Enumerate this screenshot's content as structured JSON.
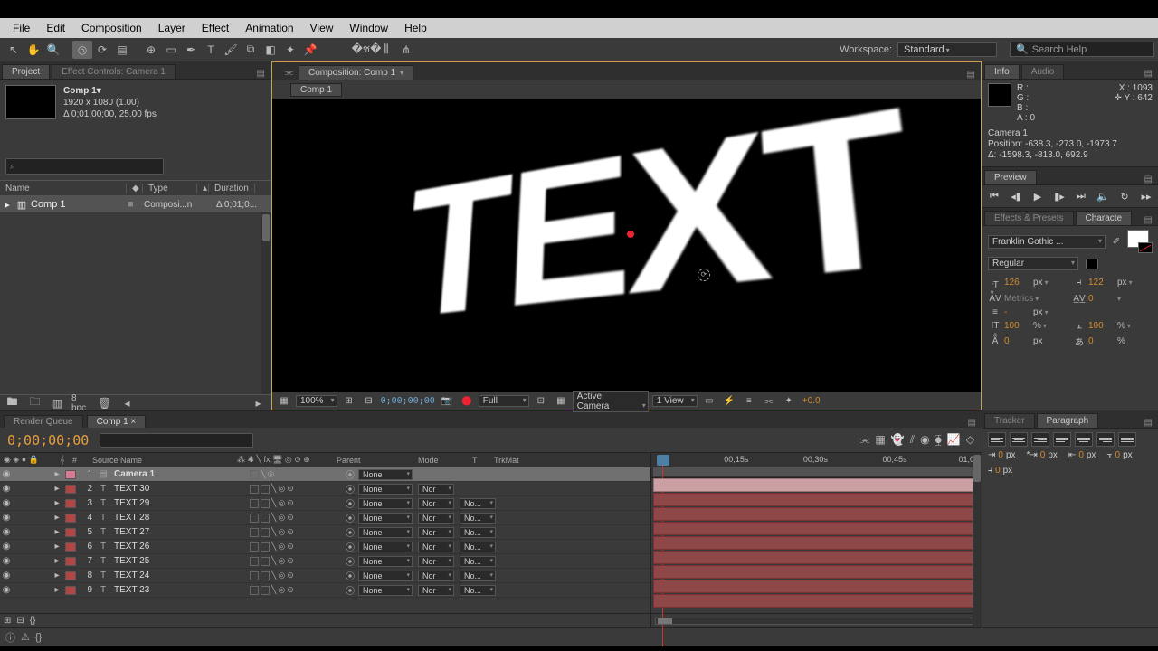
{
  "menu": [
    "File",
    "Edit",
    "Composition",
    "Layer",
    "Effect",
    "Animation",
    "View",
    "Window",
    "Help"
  ],
  "workspace": {
    "label": "Workspace:",
    "value": "Standard"
  },
  "search_help": "Search Help",
  "left": {
    "tabs": {
      "project": "Project",
      "fx": "Effect Controls: Camera 1"
    },
    "comp": {
      "title": "Comp 1▾",
      "dims": "1920 x 1080 (1.00)",
      "dur": "Δ 0;01;00;00, 25.00 fps"
    },
    "cols": {
      "name": "Name",
      "type": "Type",
      "duration": "Duration"
    },
    "row": {
      "name": "Comp 1",
      "type": "Composi...n",
      "dur": "Δ 0;01;0..."
    },
    "footer_bpc": "8 bpc"
  },
  "comp": {
    "tab": "Composition: Comp 1",
    "subtab": "Comp 1",
    "text": "TEXT",
    "footer": {
      "zoom": "100%",
      "time": "0;00;00;00",
      "res": "Full",
      "cam": "Active Camera",
      "view": "1 View",
      "exp": "+0.0"
    }
  },
  "right": {
    "tabs": {
      "info": "Info",
      "audio": "Audio"
    },
    "info": {
      "R": "R :",
      "G": "G :",
      "B": "B :",
      "A": "A :  0",
      "X": "X : 1093",
      "Y": "Y :   642",
      "cam": "Camera 1",
      "pos": "Position: -638.3, -273.0, -1973.7",
      "delta": "Δ: -1598.3, -813.0, 692.9"
    },
    "preview": "Preview",
    "fx_tabs": {
      "fx": "Effects & Presets",
      "char": "Characte"
    },
    "char": {
      "font": "Franklin Gothic ...",
      "style": "Regular",
      "size": "126",
      "size2": "122",
      "leading": "Metrics",
      "tracking": "-",
      "stroke": "-",
      "px": "px",
      "scaleV": "100",
      "scaleH": "100",
      "baseline": "0",
      "tsume": "0",
      "pct": "%"
    },
    "tracker_tabs": {
      "tracker": "Tracker",
      "para": "Paragraph"
    },
    "para": {
      "v": "0"
    }
  },
  "timeline": {
    "tabs": {
      "rq": "Render Queue",
      "comp": "Comp 1"
    },
    "time": "0;00;00;00",
    "cols": {
      "src": "Source Name",
      "parent": "Parent",
      "mode": "Mode",
      "t": "T",
      "trk": "TrkMat"
    },
    "ticks": [
      "00;15s",
      "00;30s",
      "00;45s",
      "01;0"
    ],
    "rows": [
      {
        "n": "1",
        "name": "Camera 1",
        "sw": "pink",
        "cam": true,
        "mode": "None",
        "trk": ""
      },
      {
        "n": "2",
        "name": "TEXT 30",
        "sw": "red",
        "mode": "None",
        "m": "Nor",
        "trk": ""
      },
      {
        "n": "3",
        "name": "TEXT 29",
        "sw": "red",
        "mode": "None",
        "m": "Nor",
        "trk": "No..."
      },
      {
        "n": "4",
        "name": "TEXT 28",
        "sw": "red",
        "mode": "None",
        "m": "Nor",
        "trk": "No..."
      },
      {
        "n": "5",
        "name": "TEXT 27",
        "sw": "red",
        "mode": "None",
        "m": "Nor",
        "trk": "No..."
      },
      {
        "n": "6",
        "name": "TEXT 26",
        "sw": "red",
        "mode": "None",
        "m": "Nor",
        "trk": "No..."
      },
      {
        "n": "7",
        "name": "TEXT 25",
        "sw": "red",
        "mode": "None",
        "m": "Nor",
        "trk": "No..."
      },
      {
        "n": "8",
        "name": "TEXT 24",
        "sw": "red",
        "mode": "None",
        "m": "Nor",
        "trk": "No..."
      },
      {
        "n": "9",
        "name": "TEXT 23",
        "sw": "red",
        "mode": "None",
        "m": "Nor",
        "trk": "No..."
      }
    ]
  }
}
